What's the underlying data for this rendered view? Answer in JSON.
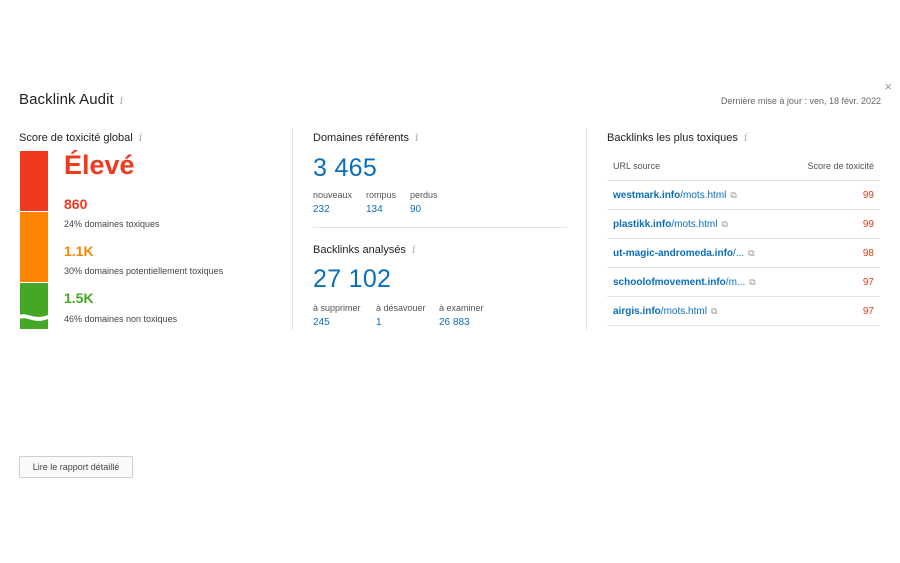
{
  "header": {
    "title": "Backlink Audit",
    "info_icon": "i",
    "updated": "Dernière mise à jour : ven, 18 févr. 2022",
    "close_icon": "×"
  },
  "toxicity": {
    "title": "Score de toxicité global",
    "level": "Élevé",
    "levels": [
      {
        "value": "860",
        "label": "24% domaines toxiques",
        "color": "#ef3a1f"
      },
      {
        "value": "1.1K",
        "label": "30% domaines potentiellement toxiques",
        "color": "#fb8500"
      },
      {
        "value": "1.5K",
        "label": "46% domaines non toxiques",
        "color": "#44a725"
      }
    ]
  },
  "referring": {
    "title": "Domaines référents",
    "total": "3 465",
    "stats": [
      {
        "label": "nouveaux",
        "value": "232"
      },
      {
        "label": "rompus",
        "value": "134"
      },
      {
        "label": "perdus",
        "value": "90"
      }
    ]
  },
  "analyzed": {
    "title": "Backlinks analysés",
    "total": "27 102",
    "stats": [
      {
        "label": "à supprimer",
        "value": "245"
      },
      {
        "label": "à désavouer",
        "value": "1"
      },
      {
        "label": "à examiner",
        "value": "26 883"
      }
    ]
  },
  "toxic_backlinks": {
    "title": "Backlinks les plus toxiques",
    "col_url": "URL source",
    "col_score": "Score de toxicité",
    "rows": [
      {
        "domain": "westmark.info",
        "path": "/mots.html",
        "score": "99"
      },
      {
        "domain": "plastikk.info",
        "path": "/mots.html",
        "score": "99"
      },
      {
        "domain": "ut-magic-andromeda.info",
        "path": "/...",
        "score": "98"
      },
      {
        "domain": "schoolofmovement.info",
        "path": "/m...",
        "score": "97"
      },
      {
        "domain": "airgis.info",
        "path": "/mots.html",
        "score": "97"
      }
    ]
  },
  "actions": {
    "report_button": "Lire le rapport détaillé"
  },
  "colors": {
    "accent": "#0a6ebd",
    "toxic": "#e33b1c"
  }
}
